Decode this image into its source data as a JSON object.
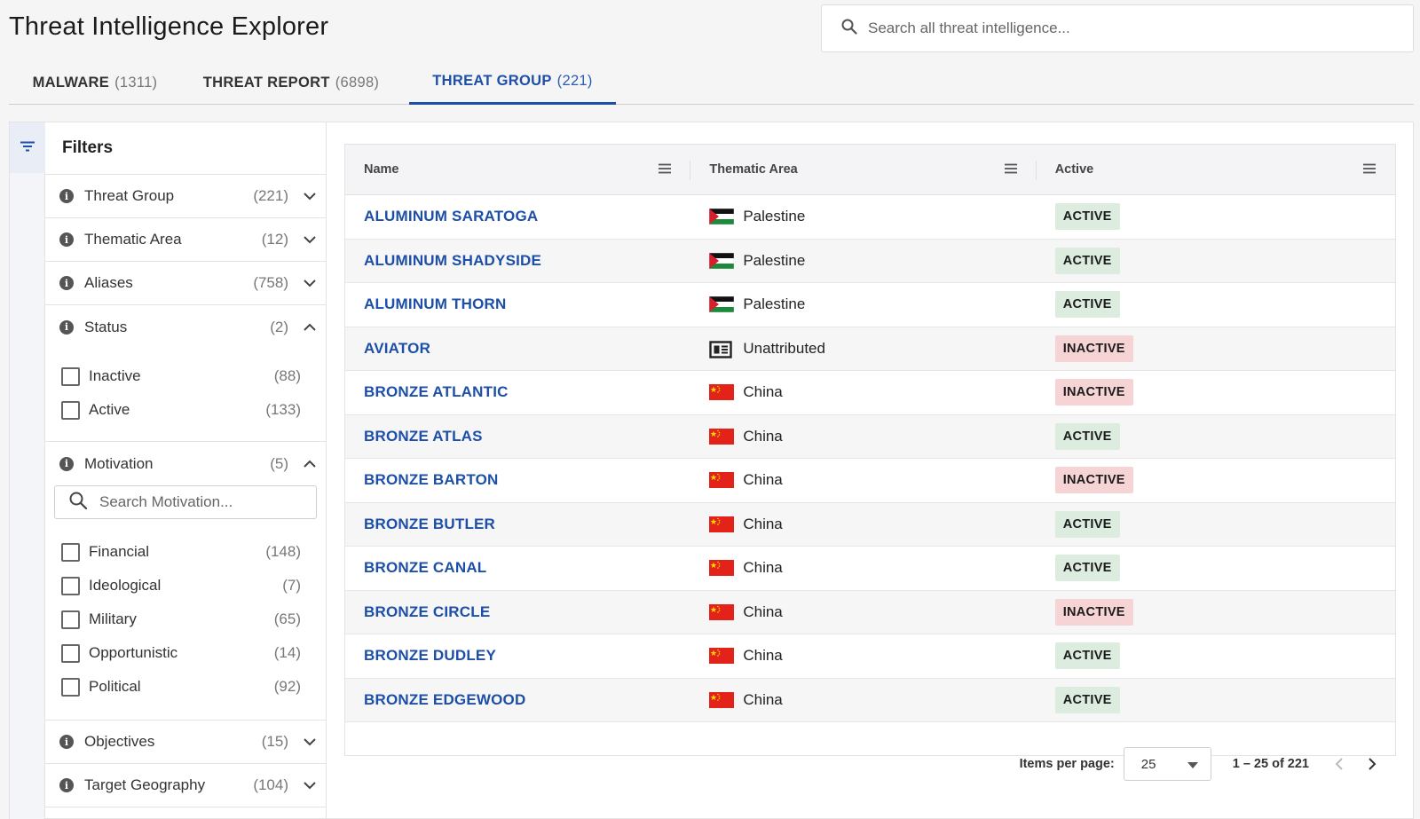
{
  "header": {
    "title": "Threat Intelligence Explorer",
    "search_placeholder": "Search all threat intelligence..."
  },
  "tabs": [
    {
      "label": "MALWARE",
      "count": "(1311)"
    },
    {
      "label": "THREAT REPORT",
      "count": "(6898)"
    },
    {
      "label": "THREAT GROUP",
      "count": "(221)",
      "active": true
    }
  ],
  "filters": {
    "title": "Filters",
    "facets": [
      {
        "label": "Threat Group",
        "count": "(221)"
      },
      {
        "label": "Thematic Area",
        "count": "(12)"
      },
      {
        "label": "Aliases",
        "count": "(758)"
      },
      {
        "label": "Status",
        "count": "(2)"
      },
      {
        "label": "Motivation",
        "count": "(5)"
      },
      {
        "label": "Objectives",
        "count": "(15)"
      },
      {
        "label": "Target Geography",
        "count": "(104)"
      }
    ],
    "status_options": [
      {
        "label": "Inactive",
        "count": "(88)"
      },
      {
        "label": "Active",
        "count": "(133)"
      }
    ],
    "motivation_search_placeholder": "Search Motivation...",
    "motivation_options": [
      {
        "label": "Financial",
        "count": "(148)"
      },
      {
        "label": "Ideological",
        "count": "(7)"
      },
      {
        "label": "Military",
        "count": "(65)"
      },
      {
        "label": "Opportunistic",
        "count": "(14)"
      },
      {
        "label": "Political",
        "count": "(92)"
      }
    ]
  },
  "table": {
    "columns": [
      "Name",
      "Thematic Area",
      "Active"
    ],
    "rows": [
      {
        "name": "ALUMINUM SARATOGA",
        "area": "Palestine",
        "flag": "palestine",
        "status": "ACTIVE"
      },
      {
        "name": "ALUMINUM SHADYSIDE",
        "area": "Palestine",
        "flag": "palestine",
        "status": "ACTIVE"
      },
      {
        "name": "ALUMINUM THORN",
        "area": "Palestine",
        "flag": "palestine",
        "status": "ACTIVE"
      },
      {
        "name": "AVIATOR",
        "area": "Unattributed",
        "flag": "unattributed",
        "status": "INACTIVE"
      },
      {
        "name": "BRONZE ATLANTIC",
        "area": "China",
        "flag": "china",
        "status": "INACTIVE"
      },
      {
        "name": "BRONZE ATLAS",
        "area": "China",
        "flag": "china",
        "status": "ACTIVE"
      },
      {
        "name": "BRONZE BARTON",
        "area": "China",
        "flag": "china",
        "status": "INACTIVE"
      },
      {
        "name": "BRONZE BUTLER",
        "area": "China",
        "flag": "china",
        "status": "ACTIVE"
      },
      {
        "name": "BRONZE CANAL",
        "area": "China",
        "flag": "china",
        "status": "ACTIVE"
      },
      {
        "name": "BRONZE CIRCLE",
        "area": "China",
        "flag": "china",
        "status": "INACTIVE"
      },
      {
        "name": "BRONZE DUDLEY",
        "area": "China",
        "flag": "china",
        "status": "ACTIVE"
      },
      {
        "name": "BRONZE EDGEWOOD",
        "area": "China",
        "flag": "china",
        "status": "ACTIVE"
      }
    ]
  },
  "pagination": {
    "items_per_page_label": "Items per page:",
    "items_per_page": "25",
    "range": "1 – 25 of 221"
  },
  "colors": {
    "link": "#1d4fa8",
    "active_badge": "#dcecdf",
    "inactive_badge": "#f6d3d4"
  }
}
